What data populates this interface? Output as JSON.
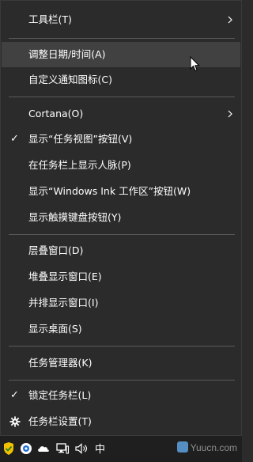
{
  "context_menu": {
    "items": [
      {
        "label": "工具栏(T)",
        "submenu": true
      },
      {
        "label": "调整日期/时间(A)",
        "hover": true
      },
      {
        "label": "自定义通知图标(C)"
      },
      {
        "label": "Cortana(O)",
        "submenu": true
      },
      {
        "label": "显示“任务视图”按钮(V)",
        "checked": true
      },
      {
        "label": "在任务栏上显示人脉(P)"
      },
      {
        "label": "显示“Windows Ink 工作区”按钮(W)"
      },
      {
        "label": "显示触摸键盘按钮(Y)"
      },
      {
        "label": "层叠窗口(D)"
      },
      {
        "label": "堆叠显示窗口(E)"
      },
      {
        "label": "并排显示窗口(I)"
      },
      {
        "label": "显示桌面(S)"
      },
      {
        "label": "任务管理器(K)"
      },
      {
        "label": "锁定任务栏(L)",
        "checked": true
      },
      {
        "label": "任务栏设置(T)",
        "icon": "gear-icon"
      }
    ]
  },
  "taskbar": {
    "ime_label": "中",
    "watermark": "Yuucn.com",
    "tray_icons": [
      "shield-check-icon",
      "network-status-icon",
      "cloud-icon",
      "pc-network-icon",
      "speaker-icon"
    ]
  },
  "colors": {
    "menu_bg": "#2b2b2b",
    "hover_bg": "#414141",
    "separator": "#5a5a5a",
    "text": "#ffffff",
    "taskbar_bg": "#1f1f1f"
  }
}
